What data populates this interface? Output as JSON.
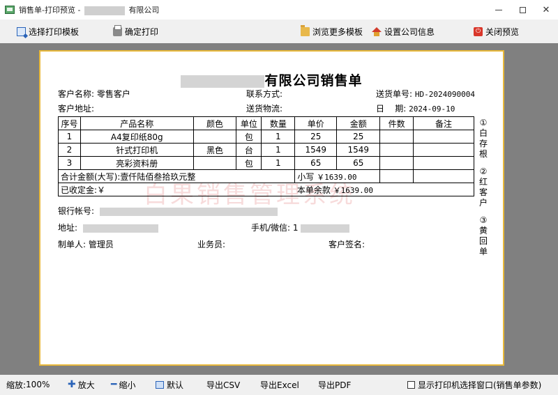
{
  "window": {
    "title_prefix": "销售单-打印预览 -",
    "title_suffix": "有限公司"
  },
  "toolbar": {
    "choose_template": "选择打印模板",
    "confirm_print": "确定打印",
    "browse_templates": "浏览更多模板",
    "company_info": "设置公司信息",
    "close_preview": "关闭预览"
  },
  "doc": {
    "title_suffix": "有限公司销售单",
    "customer_name_label": "客户名称:",
    "customer_name": "零售客户",
    "contact_label": "联系方式:",
    "delivery_no_label": "送货单号:",
    "delivery_no": "HD-2024090004",
    "customer_address_label": "客户地址:",
    "logistics_label": "送货物流:",
    "date_label": "日    期:",
    "date": "2024-09-10",
    "headers": [
      "序号",
      "产品名称",
      "颜色",
      "单位",
      "数量",
      "单价",
      "金额",
      "件数",
      "备注"
    ],
    "rows": [
      [
        "1",
        "A4复印纸80g",
        "",
        "包",
        "1",
        "25",
        "25",
        "",
        ""
      ],
      [
        "2",
        "针式打印机",
        "黑色",
        "台",
        "1",
        "1549",
        "1549",
        "",
        ""
      ],
      [
        "3",
        "亮彩资料册",
        "",
        "包",
        "1",
        "65",
        "65",
        "",
        ""
      ]
    ],
    "total_label": "合计金额(大写):",
    "total_upper": "壹仟陆佰叁拾玖元整",
    "total_small_label": "小写",
    "total_small": "￥1639.00",
    "received_label": "已收定金:",
    "received_value": "￥",
    "balance_label": "本单余款",
    "balance_value": "￥1639.00",
    "bank_label": "银行帐号:",
    "address_label": "地址:",
    "phone_label": "手机/微信:",
    "phone_prefix": "1",
    "maker_label": "制单人:",
    "maker": "管理员",
    "salesman_label": "业务员:",
    "sign_label": "客户签名:",
    "side_notes": [
      "①白存根",
      "②红客户",
      "③黄回单"
    ],
    "watermark": "白果销售管理系统"
  },
  "statusbar": {
    "zoom_label": "缩放:",
    "zoom_value": "100%",
    "zoom_in": "放大",
    "zoom_out": "缩小",
    "reset": "默认",
    "export_csv": "导出CSV",
    "export_excel": "导出Excel",
    "export_pdf": "导出PDF",
    "show_printer_dialog": "显示打印机选择窗口(销售单参数)"
  }
}
